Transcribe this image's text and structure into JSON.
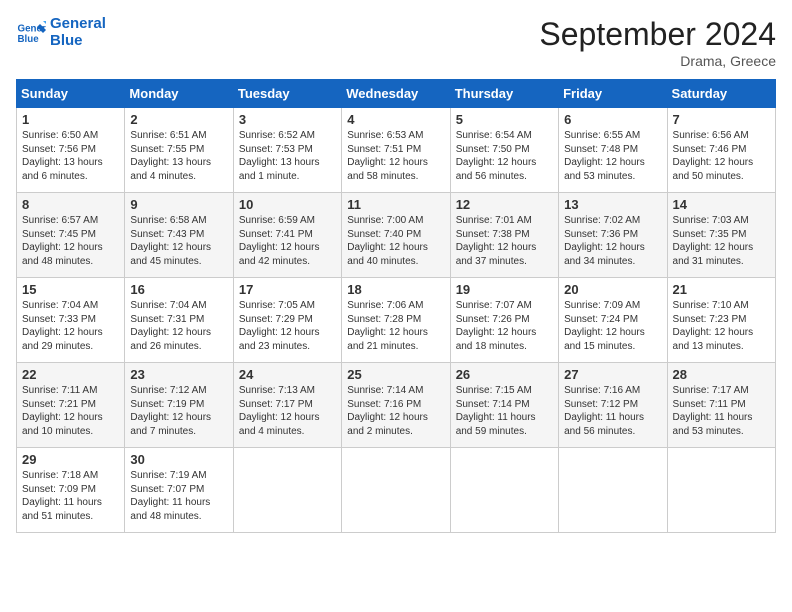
{
  "logo": {
    "line1": "General",
    "line2": "Blue"
  },
  "title": "September 2024",
  "subtitle": "Drama, Greece",
  "days_of_week": [
    "Sunday",
    "Monday",
    "Tuesday",
    "Wednesday",
    "Thursday",
    "Friday",
    "Saturday"
  ],
  "weeks": [
    [
      {
        "day": 1,
        "lines": [
          "Sunrise: 6:50 AM",
          "Sunset: 7:56 PM",
          "Daylight: 13 hours",
          "and 6 minutes."
        ]
      },
      {
        "day": 2,
        "lines": [
          "Sunrise: 6:51 AM",
          "Sunset: 7:55 PM",
          "Daylight: 13 hours",
          "and 4 minutes."
        ]
      },
      {
        "day": 3,
        "lines": [
          "Sunrise: 6:52 AM",
          "Sunset: 7:53 PM",
          "Daylight: 13 hours",
          "and 1 minute."
        ]
      },
      {
        "day": 4,
        "lines": [
          "Sunrise: 6:53 AM",
          "Sunset: 7:51 PM",
          "Daylight: 12 hours",
          "and 58 minutes."
        ]
      },
      {
        "day": 5,
        "lines": [
          "Sunrise: 6:54 AM",
          "Sunset: 7:50 PM",
          "Daylight: 12 hours",
          "and 56 minutes."
        ]
      },
      {
        "day": 6,
        "lines": [
          "Sunrise: 6:55 AM",
          "Sunset: 7:48 PM",
          "Daylight: 12 hours",
          "and 53 minutes."
        ]
      },
      {
        "day": 7,
        "lines": [
          "Sunrise: 6:56 AM",
          "Sunset: 7:46 PM",
          "Daylight: 12 hours",
          "and 50 minutes."
        ]
      }
    ],
    [
      {
        "day": 8,
        "lines": [
          "Sunrise: 6:57 AM",
          "Sunset: 7:45 PM",
          "Daylight: 12 hours",
          "and 48 minutes."
        ]
      },
      {
        "day": 9,
        "lines": [
          "Sunrise: 6:58 AM",
          "Sunset: 7:43 PM",
          "Daylight: 12 hours",
          "and 45 minutes."
        ]
      },
      {
        "day": 10,
        "lines": [
          "Sunrise: 6:59 AM",
          "Sunset: 7:41 PM",
          "Daylight: 12 hours",
          "and 42 minutes."
        ]
      },
      {
        "day": 11,
        "lines": [
          "Sunrise: 7:00 AM",
          "Sunset: 7:40 PM",
          "Daylight: 12 hours",
          "and 40 minutes."
        ]
      },
      {
        "day": 12,
        "lines": [
          "Sunrise: 7:01 AM",
          "Sunset: 7:38 PM",
          "Daylight: 12 hours",
          "and 37 minutes."
        ]
      },
      {
        "day": 13,
        "lines": [
          "Sunrise: 7:02 AM",
          "Sunset: 7:36 PM",
          "Daylight: 12 hours",
          "and 34 minutes."
        ]
      },
      {
        "day": 14,
        "lines": [
          "Sunrise: 7:03 AM",
          "Sunset: 7:35 PM",
          "Daylight: 12 hours",
          "and 31 minutes."
        ]
      }
    ],
    [
      {
        "day": 15,
        "lines": [
          "Sunrise: 7:04 AM",
          "Sunset: 7:33 PM",
          "Daylight: 12 hours",
          "and 29 minutes."
        ]
      },
      {
        "day": 16,
        "lines": [
          "Sunrise: 7:04 AM",
          "Sunset: 7:31 PM",
          "Daylight: 12 hours",
          "and 26 minutes."
        ]
      },
      {
        "day": 17,
        "lines": [
          "Sunrise: 7:05 AM",
          "Sunset: 7:29 PM",
          "Daylight: 12 hours",
          "and 23 minutes."
        ]
      },
      {
        "day": 18,
        "lines": [
          "Sunrise: 7:06 AM",
          "Sunset: 7:28 PM",
          "Daylight: 12 hours",
          "and 21 minutes."
        ]
      },
      {
        "day": 19,
        "lines": [
          "Sunrise: 7:07 AM",
          "Sunset: 7:26 PM",
          "Daylight: 12 hours",
          "and 18 minutes."
        ]
      },
      {
        "day": 20,
        "lines": [
          "Sunrise: 7:09 AM",
          "Sunset: 7:24 PM",
          "Daylight: 12 hours",
          "and 15 minutes."
        ]
      },
      {
        "day": 21,
        "lines": [
          "Sunrise: 7:10 AM",
          "Sunset: 7:23 PM",
          "Daylight: 12 hours",
          "and 13 minutes."
        ]
      }
    ],
    [
      {
        "day": 22,
        "lines": [
          "Sunrise: 7:11 AM",
          "Sunset: 7:21 PM",
          "Daylight: 12 hours",
          "and 10 minutes."
        ]
      },
      {
        "day": 23,
        "lines": [
          "Sunrise: 7:12 AM",
          "Sunset: 7:19 PM",
          "Daylight: 12 hours",
          "and 7 minutes."
        ]
      },
      {
        "day": 24,
        "lines": [
          "Sunrise: 7:13 AM",
          "Sunset: 7:17 PM",
          "Daylight: 12 hours",
          "and 4 minutes."
        ]
      },
      {
        "day": 25,
        "lines": [
          "Sunrise: 7:14 AM",
          "Sunset: 7:16 PM",
          "Daylight: 12 hours",
          "and 2 minutes."
        ]
      },
      {
        "day": 26,
        "lines": [
          "Sunrise: 7:15 AM",
          "Sunset: 7:14 PM",
          "Daylight: 11 hours",
          "and 59 minutes."
        ]
      },
      {
        "day": 27,
        "lines": [
          "Sunrise: 7:16 AM",
          "Sunset: 7:12 PM",
          "Daylight: 11 hours",
          "and 56 minutes."
        ]
      },
      {
        "day": 28,
        "lines": [
          "Sunrise: 7:17 AM",
          "Sunset: 7:11 PM",
          "Daylight: 11 hours",
          "and 53 minutes."
        ]
      }
    ],
    [
      {
        "day": 29,
        "lines": [
          "Sunrise: 7:18 AM",
          "Sunset: 7:09 PM",
          "Daylight: 11 hours",
          "and 51 minutes."
        ]
      },
      {
        "day": 30,
        "lines": [
          "Sunrise: 7:19 AM",
          "Sunset: 7:07 PM",
          "Daylight: 11 hours",
          "and 48 minutes."
        ]
      },
      null,
      null,
      null,
      null,
      null
    ]
  ]
}
